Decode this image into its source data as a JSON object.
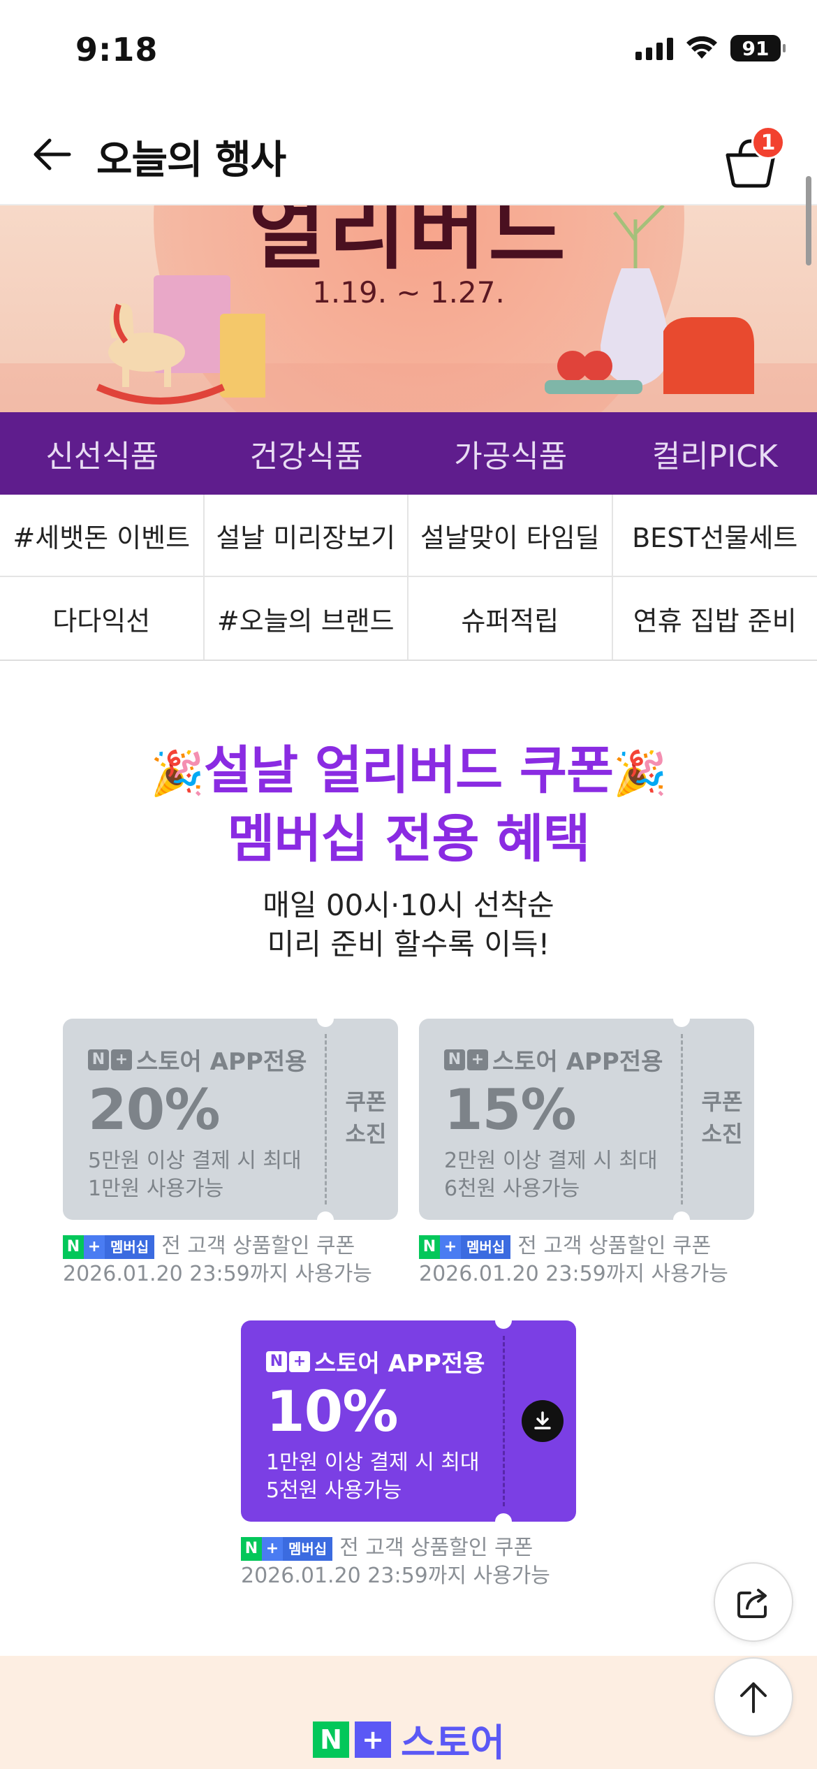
{
  "status_bar": {
    "time": "9:18",
    "battery": "91"
  },
  "header": {
    "title": "오늘의 행사",
    "cart_count": "1"
  },
  "banner": {
    "heading": "얼리버드",
    "dates": "1.19. ~ 1.27."
  },
  "category_tabs": [
    "신선식품",
    "건강식품",
    "가공식품",
    "컬리PICK"
  ],
  "sub_categories": [
    "#세뱃돈 이벤트",
    "설날 미리장보기",
    "설날맞이 타임딜",
    "BEST선물세트",
    "다다익선",
    "#오늘의 브랜드",
    "슈퍼적립",
    "연휴 집밥 준비"
  ],
  "promo": {
    "title_line1": "설날 얼리버드 쿠폰",
    "title_line2": "멤버십 전용 혜택",
    "party_emoji": "🎉",
    "sub_line1": "매일 00시·10시 선착순",
    "sub_line2": "미리 준비 할수록 이득!"
  },
  "coupons": [
    {
      "store_label": "스토어 APP전용",
      "discount": "20%",
      "cond_line1": "5만원 이상 결제 시 최대",
      "cond_line2": "1만원 사용가능",
      "status_line1": "쿠폰",
      "status_line2": "소진",
      "note_tag": "멤버십",
      "note_line1": "전 고객 상품할인 쿠폰",
      "note_line2": "2026.01.20 23:59까지 사용가능"
    },
    {
      "store_label": "스토어 APP전용",
      "discount": "15%",
      "cond_line1": "2만원 이상 결제 시 최대",
      "cond_line2": "6천원 사용가능",
      "status_line1": "쿠폰",
      "status_line2": "소진",
      "note_tag": "멤버십",
      "note_line1": "전 고객 상품할인 쿠폰",
      "note_line2": "2026.01.20 23:59까지 사용가능"
    },
    {
      "store_label": "스토어 APP전용",
      "discount": "10%",
      "cond_line1": "1만원 이상 결제 시 최대",
      "cond_line2": "5천원 사용가능",
      "note_tag": "멤버십",
      "note_line1": "전 고객 상품할인 쿠폰",
      "note_line2": "2026.01.20 23:59까지 사용가능"
    }
  ],
  "bottom": {
    "store_text": "스토어"
  },
  "colors": {
    "brand_purple": "#5f1d8d",
    "promo_purple": "#8a2be2",
    "coupon_active": "#7b3fe4",
    "coupon_used": "#d2d7dc",
    "naver_green": "#03c75a"
  },
  "icons": [
    "back-arrow-icon",
    "cart-icon",
    "share-icon",
    "scroll-top-icon",
    "download-icon",
    "signal-icon",
    "wifi-icon",
    "battery-icon"
  ]
}
